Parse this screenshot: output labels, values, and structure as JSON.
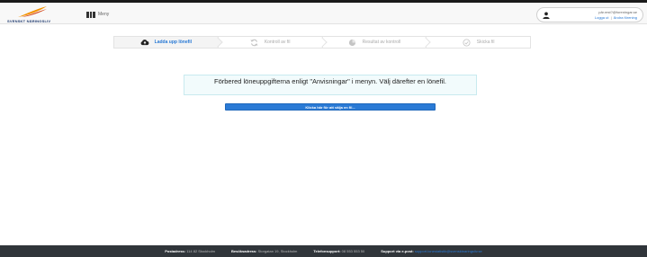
{
  "header": {
    "logo_text": "SVENSKT NÄRINGSLIV",
    "menu_label": "Meny",
    "user": {
      "email": "pär.rest?@foreningar.se",
      "logout_label": "Logga ut",
      "separator": "|",
      "switch_label": "Ändra förening"
    }
  },
  "steps": [
    {
      "label": "Ladda upp lönefil",
      "icon": "cloud-upload-icon",
      "active": true
    },
    {
      "label": "Kontroll av fil",
      "icon": "refresh-icon",
      "active": false
    },
    {
      "label": "Resultat av kontroll",
      "icon": "pie-chart-icon",
      "active": false
    },
    {
      "label": "Skicka fil",
      "icon": "check-circle-icon",
      "active": false
    }
  ],
  "main": {
    "info_text": "Förbered löneuppgifterna enligt \"Anvisningar\" i menyn. Välj därefter en lönefil.",
    "file_button_label": "Klicka här för att välja en fil..."
  },
  "footer": {
    "postal_label": "Postadress:",
    "postal_value": "114 82 Stockholm",
    "visit_label": "Besöksadress:",
    "visit_value": "Storgatan 19, Stockholm",
    "phone_label": "Telefonsupport:",
    "phone_value": "08 553 553 50",
    "email_label": "Support via e-post:",
    "email_value": "support.lonestatistik@svensktnaringsliv.se"
  },
  "colors": {
    "accent": "#2a7ad5",
    "logo_orange": "#f39200",
    "logo_navy": "#1f3a6e",
    "footer_bg": "#30353a"
  }
}
